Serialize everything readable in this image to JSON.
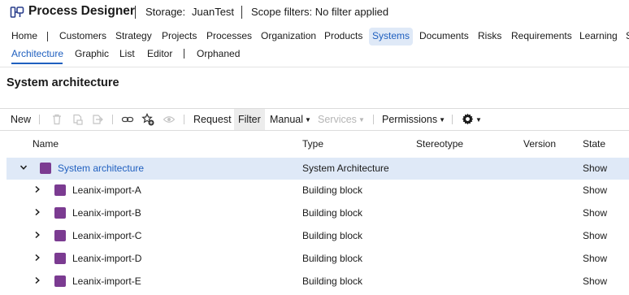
{
  "header": {
    "app_title": "Process Designer",
    "storage_label": "Storage:",
    "storage_value": "JuanTest",
    "scope_filters": "Scope filters: No filter applied"
  },
  "nav": {
    "items": [
      "Home",
      "Customers",
      "Strategy",
      "Projects",
      "Processes",
      "Organization",
      "Products",
      "Systems",
      "Documents",
      "Risks",
      "Requirements",
      "Learning",
      "S"
    ],
    "active": "Systems"
  },
  "subnav": {
    "items": [
      "Architecture",
      "Graphic",
      "List",
      "Editor",
      "Orphaned"
    ],
    "active": "Architecture"
  },
  "page_title": "System architecture",
  "toolbar": {
    "new": "New",
    "request": "Request",
    "filter": "Filter",
    "manual": "Manual",
    "services": "Services",
    "permissions": "Permissions",
    "icons": [
      "trash-icon",
      "copy-icon",
      "move-icon",
      "link-icon",
      "favorite-add-icon",
      "watch-icon",
      "gear-icon"
    ]
  },
  "table": {
    "columns": [
      "Name",
      "Type",
      "Stereotype",
      "Version",
      "State"
    ],
    "rows": [
      {
        "name": "System architecture",
        "type": "System Architecture",
        "stereotype": "",
        "version": "",
        "state": "Show",
        "expanded": true,
        "selected": true
      },
      {
        "name": "Leanix-import-A",
        "type": "Building block",
        "stereotype": "",
        "version": "",
        "state": "Show"
      },
      {
        "name": "Leanix-import-B",
        "type": "Building block",
        "stereotype": "",
        "version": "",
        "state": "Show"
      },
      {
        "name": "Leanix-import-C",
        "type": "Building block",
        "stereotype": "",
        "version": "",
        "state": "Show"
      },
      {
        "name": "Leanix-import-D",
        "type": "Building block",
        "stereotype": "",
        "version": "",
        "state": "Show"
      },
      {
        "name": "Leanix-import-E",
        "type": "Building block",
        "stereotype": "",
        "version": "",
        "state": "Show"
      }
    ]
  },
  "colors": {
    "accent": "#1f5fbf",
    "selected_row": "#dfe9f7",
    "item_icon": "#7b3b91",
    "disabled": "#b5b5b5"
  }
}
